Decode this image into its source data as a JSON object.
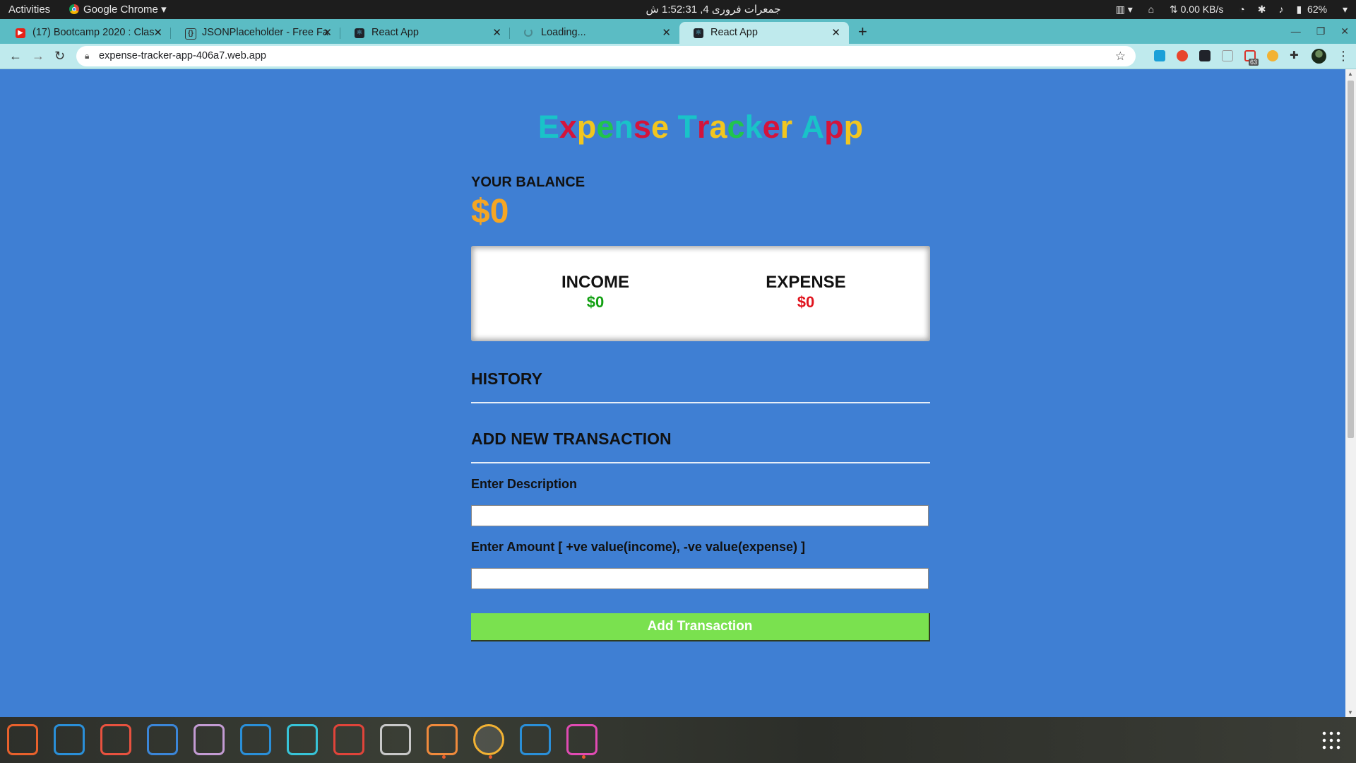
{
  "system_bar": {
    "activities": "Activities",
    "app_name": "Google Chrome",
    "clock": "جمعرات فروری 4, 1:52:31 ش",
    "network_speed": "⇅ 0.00 KB/s",
    "battery": "62%"
  },
  "browser": {
    "tabs": [
      {
        "title": "(17) Bootcamp 2020 : Clas",
        "icon": "youtube-icon",
        "active": false
      },
      {
        "title": "JSONPlaceholder - Free Fa",
        "icon": "json-icon",
        "active": false
      },
      {
        "title": "React App",
        "icon": "react-icon",
        "active": false
      },
      {
        "title": "Loading...",
        "icon": "loading-icon",
        "active": false
      },
      {
        "title": "React App",
        "icon": "react-icon",
        "active": true
      }
    ],
    "new_tab": "+",
    "url": "expense-tracker-app-406a7.web.app",
    "extension_badge": "63"
  },
  "app": {
    "title_letters": [
      {
        "ch": "E",
        "color": "#19c3c8"
      },
      {
        "ch": "x",
        "color": "#d4143c"
      },
      {
        "ch": "p",
        "color": "#f2c61f"
      },
      {
        "ch": "e",
        "color": "#21c44d"
      },
      {
        "ch": "n",
        "color": "#19c3c8"
      },
      {
        "ch": "s",
        "color": "#d4143c"
      },
      {
        "ch": "e",
        "color": "#f2c61f"
      },
      {
        "ch": " ",
        "color": "#19c3c8"
      },
      {
        "ch": "T",
        "color": "#19c3c8"
      },
      {
        "ch": "r",
        "color": "#d4143c"
      },
      {
        "ch": "a",
        "color": "#f2c61f"
      },
      {
        "ch": "c",
        "color": "#21c44d"
      },
      {
        "ch": "k",
        "color": "#19c3c8"
      },
      {
        "ch": "e",
        "color": "#d4143c"
      },
      {
        "ch": "r",
        "color": "#f2c61f"
      },
      {
        "ch": " ",
        "color": "#19c3c8"
      },
      {
        "ch": "A",
        "color": "#19c3c8"
      },
      {
        "ch": "p",
        "color": "#d4143c"
      },
      {
        "ch": "p",
        "color": "#f2c61f"
      }
    ],
    "balance_label": "YOUR BALANCE",
    "balance_value": "$0",
    "income_label": "INCOME",
    "income_value": "$0",
    "expense_label": "EXPENSE",
    "expense_value": "$0",
    "history_heading": "HISTORY",
    "add_heading": "ADD NEW TRANSACTION",
    "description_label": "Enter Description",
    "description_value": "",
    "amount_label": "Enter Amount [ +ve value(income), -ve value(expense) ]",
    "amount_value": "",
    "submit_label": "Add Transaction"
  },
  "colors": {
    "page_background": "#3f7fd3",
    "balance": "#f5a623",
    "income": "#12a012",
    "expense": "#e0141e",
    "button": "#7ae14f",
    "tab_strip": "#5bbcc4"
  },
  "dock": [
    {
      "name": "firefox-icon",
      "running": false
    },
    {
      "name": "mail-icon",
      "running": false
    },
    {
      "name": "music-icon",
      "running": false
    },
    {
      "name": "text-editor-icon",
      "running": false
    },
    {
      "name": "software-updater-icon",
      "running": false
    },
    {
      "name": "help-icon",
      "running": false
    },
    {
      "name": "terminal-icon",
      "running": false
    },
    {
      "name": "pdf-viewer-icon",
      "running": false
    },
    {
      "name": "document-viewer-icon",
      "running": false
    },
    {
      "name": "files-icon",
      "running": true
    },
    {
      "name": "chrome-icon",
      "running": true
    },
    {
      "name": "vscode-icon",
      "running": false
    },
    {
      "name": "notes-icon",
      "running": true
    }
  ]
}
